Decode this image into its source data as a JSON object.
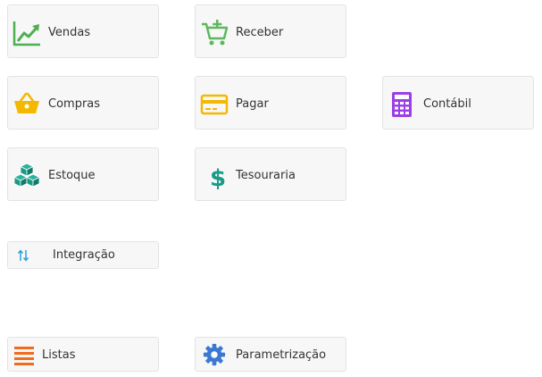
{
  "tiles": {
    "vendas": {
      "label": "Vendas",
      "icon": "chart-line-icon",
      "color": "#4caf50"
    },
    "receber": {
      "label": "Receber",
      "icon": "cart-plus-icon",
      "color": "#5cb85c"
    },
    "compras": {
      "label": "Compras",
      "icon": "basket-icon",
      "color": "#f5b800"
    },
    "pagar": {
      "label": "Pagar",
      "icon": "credit-card-icon",
      "color": "#f5b800"
    },
    "contabil": {
      "label": "Contábil",
      "icon": "calculator-icon",
      "color": "#9c3fe6"
    },
    "estoque": {
      "label": "Estoque",
      "icon": "cubes-icon",
      "color": "#1a9a86"
    },
    "tesouraria": {
      "label": "Tesouraria",
      "icon": "dollar-icon",
      "color": "#1a9a86"
    },
    "integracao": {
      "label": "Integração",
      "icon": "arrows-up-down-icon",
      "color": "#2aa3d8"
    },
    "listas": {
      "label": "Listas",
      "icon": "list-icon",
      "color": "#f26a1b"
    },
    "parametrizacao": {
      "label": "Parametrização",
      "icon": "gear-icon",
      "color": "#3a78d4"
    }
  }
}
